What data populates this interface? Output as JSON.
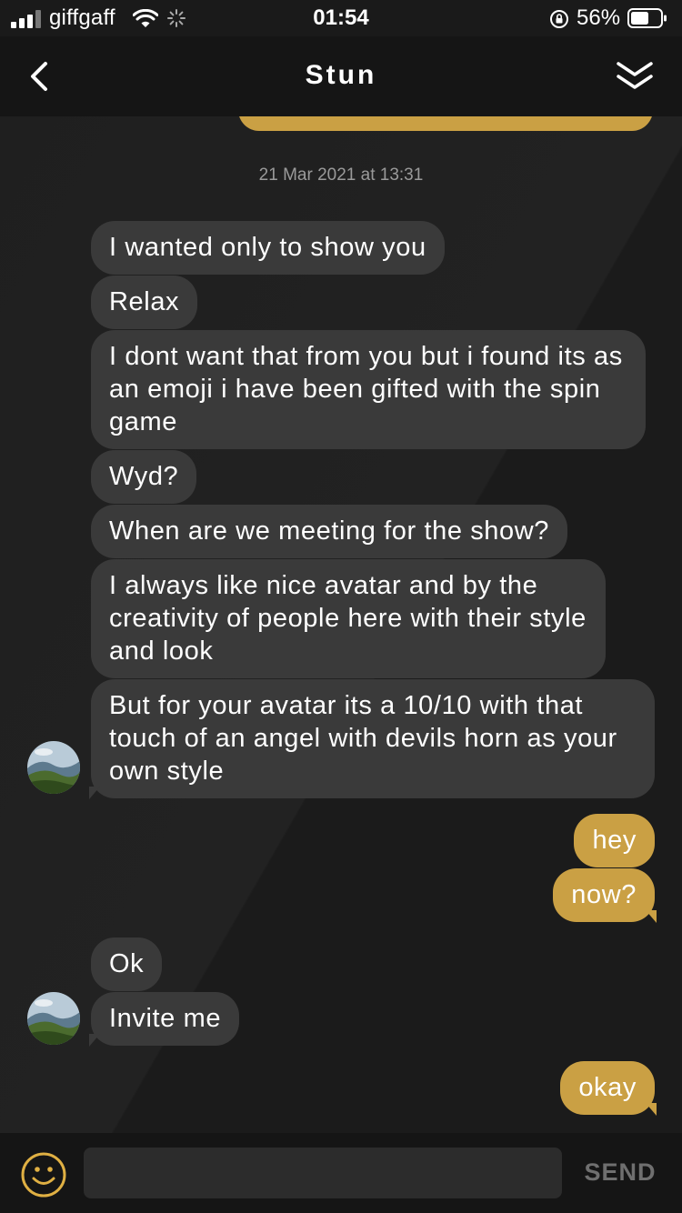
{
  "status_bar": {
    "carrier": "giffgaff",
    "time": "01:54",
    "battery": "56%"
  },
  "nav": {
    "title": "Stun",
    "back_icon": "chevron-left-icon",
    "collapse_icon": "double-chevron-down-icon"
  },
  "chat": {
    "timestamp": "21 Mar 2021 at 13:31",
    "messages": [
      {
        "side": "in",
        "text": "I wanted only to show you"
      },
      {
        "side": "in",
        "text": "Relax"
      },
      {
        "side": "in",
        "text": "I dont want that from you but i found its as an emoji i have been gifted with the spin game"
      },
      {
        "side": "in",
        "text": "Wyd?"
      },
      {
        "side": "in",
        "text": "When are we meeting for the show?"
      },
      {
        "side": "in",
        "text": "I always like nice avatar and by the creativity of people here with their style and look"
      },
      {
        "side": "in",
        "text": "But for your avatar its a 10/10 with that touch of an angel with devils horn as your own style"
      },
      {
        "side": "out",
        "text": "hey"
      },
      {
        "side": "out",
        "text": "now?"
      },
      {
        "side": "in",
        "text": "Ok"
      },
      {
        "side": "in",
        "text": "Invite me"
      },
      {
        "side": "out",
        "text": "okay"
      }
    ]
  },
  "input": {
    "placeholder": "",
    "send_label": "SEND",
    "emoji_icon": "smiley-face-icon"
  },
  "colors": {
    "background": "#1a1a1a",
    "incoming_bubble": "#3a3a3a",
    "outgoing_bubble": "#caa044",
    "accent": "#e0b043",
    "send_disabled": "#6f6f6f"
  }
}
